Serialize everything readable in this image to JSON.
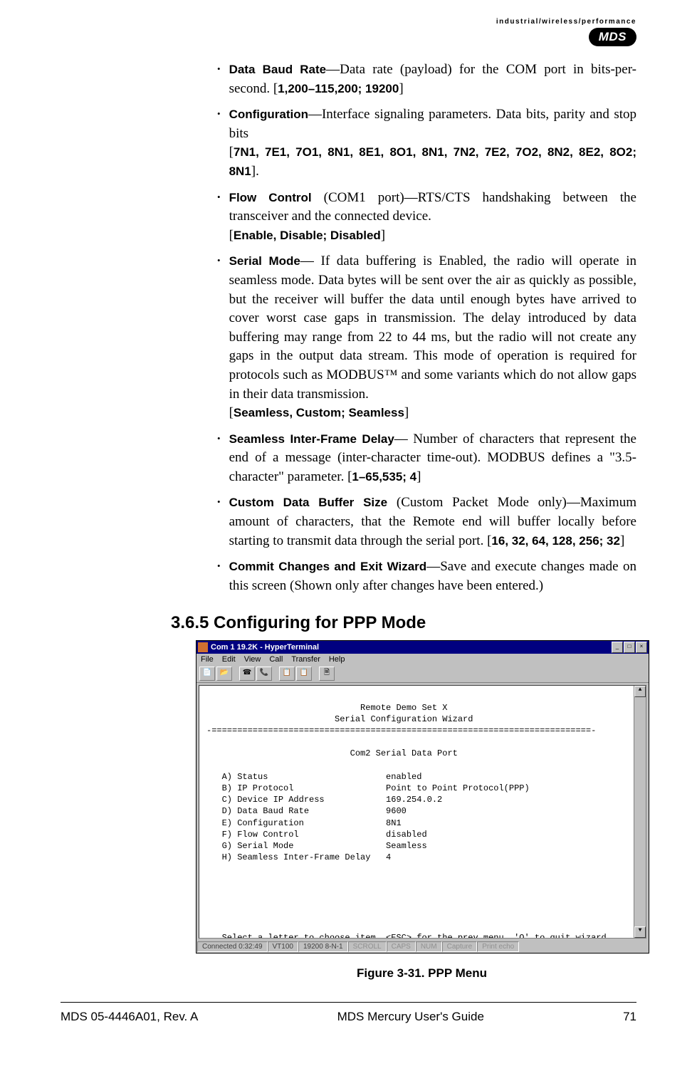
{
  "header": {
    "tagline": "industrial/wireless/performance",
    "logo": "MDS"
  },
  "items": [
    {
      "term": "Data Baud Rate",
      "text": "—Data rate (payload) for the COM port in bits-per-second. [",
      "param": "1,200–115,200; 19200",
      "tail": "]"
    },
    {
      "term": "Configuration",
      "text": "—Interface signaling parameters. Data bits, parity and stop bits",
      "line2": "[",
      "param": "7N1, 7E1, 7O1, 8N1, 8E1, 8O1, 8N1, 7N2, 7E2, 7O2, 8N2, 8E2, 8O2; 8N1",
      "tail": "]."
    },
    {
      "term": "Flow Control",
      "text": " (COM1 port)—RTS/CTS handshaking between the transceiver and the connected device.",
      "line2": "[",
      "param": "Enable, Disable; Disabled",
      "tail": "]"
    },
    {
      "term": "Serial Mode",
      "text": "— If data buffering is Enabled, the radio will operate in seamless mode. Data bytes will be sent over the air as quickly as possible, but the receiver will buffer the data until enough bytes have arrived to cover worst case gaps in transmission. The delay introduced by data buffering may range from 22 to 44 ms, but the radio will not create any gaps in the output data stream. This mode of operation is required for protocols such as MODBUS™ and some variants which do not allow gaps in their data transmission.",
      "line2": "[",
      "param": "Seamless, Custom; Seamless",
      "tail": "]"
    },
    {
      "term": "Seamless Inter-Frame Delay",
      "text": "— Number of characters that represent the end of a message (inter-character time-out). MODBUS defines a \"3.5-character\" parameter. [",
      "param": "1–65,535; 4",
      "tail": "]"
    },
    {
      "term": "Custom Data Buffer Size",
      "text": "  (Custom Packet Mode only)—Maximum amount of characters, that the Remote end will buffer locally before starting to transmit data through the serial port. [",
      "param": "16, 32, 64, 128, 256; 32",
      "tail": "]"
    },
    {
      "term": "Commit Changes and Exit Wizard",
      "text": "—Save and execute changes made on this screen (Shown only after changes have been entered.)"
    }
  ],
  "section_heading": "3.6.5 Configuring for PPP Mode",
  "terminal": {
    "title": "Com 1 19.2K - HyperTerminal",
    "menus": [
      "File",
      "Edit",
      "View",
      "Call",
      "Transfer",
      "Help"
    ],
    "body_title1": "Remote Demo Set X",
    "body_title2": "Serial Configuration Wizard",
    "divider": "-==========================================================================-",
    "subtitle": "Com2 Serial Data Port",
    "rows": [
      {
        "k": "A) Status",
        "v": "enabled"
      },
      {
        "k": "B) IP Protocol",
        "v": "Point to Point Protocol(PPP)"
      },
      {
        "k": "C) Device IP Address",
        "v": "169.254.0.2"
      },
      {
        "k": "D) Data Baud Rate",
        "v": "9600"
      },
      {
        "k": "E) Configuration",
        "v": "8N1"
      },
      {
        "k": "F) Flow Control",
        "v": "disabled"
      },
      {
        "k": "G) Serial Mode",
        "v": "Seamless"
      },
      {
        "k": "H) Seamless Inter-Frame Delay",
        "v": "4"
      }
    ],
    "prompt": "Select a letter to choose item, <ESC> for the prev menu, 'Q' to quit wizard",
    "status": {
      "connected": "Connected 0:32:49",
      "emulation": "VT100",
      "settings": "19200 8-N-1",
      "fields": [
        "SCROLL",
        "CAPS",
        "NUM",
        "Capture",
        "Print echo"
      ]
    }
  },
  "figure_caption": "Figure 3-31. PPP Menu",
  "footer": {
    "left": "MDS 05-4446A01, Rev. A",
    "center": "MDS Mercury User's Guide",
    "right": "71"
  }
}
